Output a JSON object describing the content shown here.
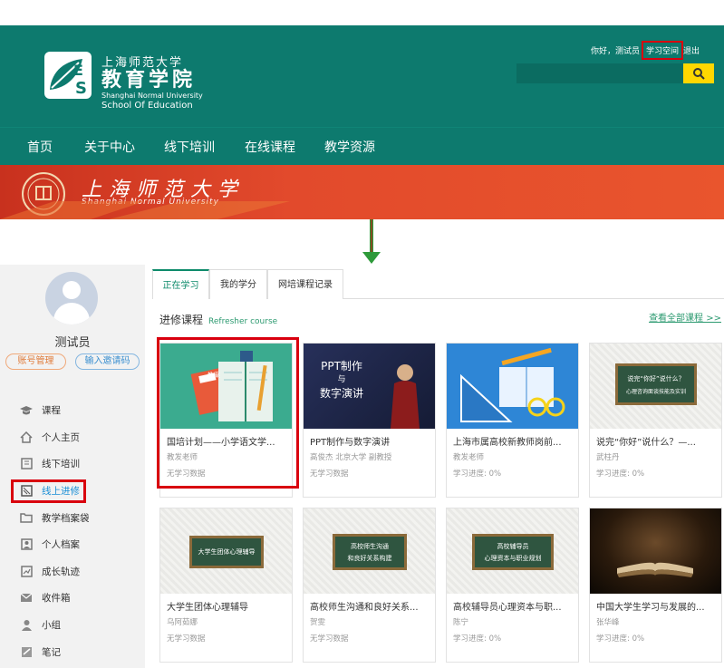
{
  "header": {
    "logo_cn_small": "上海师范大学",
    "logo_cn_big": "教育学院",
    "logo_en_1": "Shanghai Normal University",
    "logo_en_2": "School Of Education",
    "greeting": "你好，测试员",
    "study_space": "学习空间",
    "logout": "退出",
    "accent_color": "#0d7a6e",
    "search_button_color": "#ffd700"
  },
  "nav": {
    "items": [
      "首页",
      "关于中心",
      "线下培训",
      "在线课程",
      "教学资源"
    ]
  },
  "banner": {
    "cn": "上海师范大学",
    "en": "Shanghai Normal University"
  },
  "sidebar": {
    "username": "测试员",
    "account_btn": "账号管理",
    "invite_btn": "输入邀请码",
    "menu": [
      {
        "label": "课程",
        "icon": "graduation-cap-icon"
      },
      {
        "label": "个人主页",
        "icon": "home-icon"
      },
      {
        "label": "线下培训",
        "icon": "book-icon"
      },
      {
        "label": "线上进修",
        "icon": "online-study-icon"
      },
      {
        "label": "教学档案袋",
        "icon": "folder-icon"
      },
      {
        "label": "个人档案",
        "icon": "id-card-icon"
      },
      {
        "label": "成长轨迹",
        "icon": "growth-icon"
      },
      {
        "label": "收件箱",
        "icon": "mail-icon"
      },
      {
        "label": "小组",
        "icon": "user-icon"
      },
      {
        "label": "笔记",
        "icon": "note-icon"
      }
    ]
  },
  "tabs": [
    "正在学习",
    "我的学分",
    "网培课程记录"
  ],
  "section": {
    "title": "进修课程",
    "subtitle": "Refresher course",
    "view_all": "查看全部课程 >>"
  },
  "thumb_text": {
    "file_label": "教案",
    "ppt_1": "PPT制作",
    "ppt_2": "与",
    "ppt_3": "数字演讲",
    "nihao_1": "说完“你好”说什么？",
    "nihao_2": "心理咨询面谈技能及实训",
    "board_5": "大学生团体心理辅导",
    "board_6a": "高校师生沟通",
    "board_6b": "和良好关系构建",
    "board_7a": "高校辅导员",
    "board_7b": "心理资本与职业规划"
  },
  "courses": [
    {
      "title": "国培计划——小学语文学...",
      "teacher": "教发老师",
      "progress": "无学习数据"
    },
    {
      "title": "PPT制作与数字演讲",
      "teacher": "高俊杰 北京大学 副教授",
      "progress": "无学习数据"
    },
    {
      "title": "上海市属高校新教师岗前...",
      "teacher": "教发老师",
      "progress": "学习进度: 0%"
    },
    {
      "title": "说完“你好”说什么？—...",
      "teacher": "武柱丹",
      "progress": "学习进度: 0%"
    },
    {
      "title": "大学生团体心理辅导",
      "teacher": "乌阿茹娜",
      "progress": "无学习数据"
    },
    {
      "title": "高校师生沟通和良好关系...",
      "teacher": "贺雯",
      "progress": "无学习数据"
    },
    {
      "title": "高校辅导员心理资本与职...",
      "teacher": "陈宁",
      "progress": "学习进度: 0%"
    },
    {
      "title": "中国大学生学习与发展的...",
      "teacher": "张华峰",
      "progress": "学习进度: 0%"
    }
  ]
}
